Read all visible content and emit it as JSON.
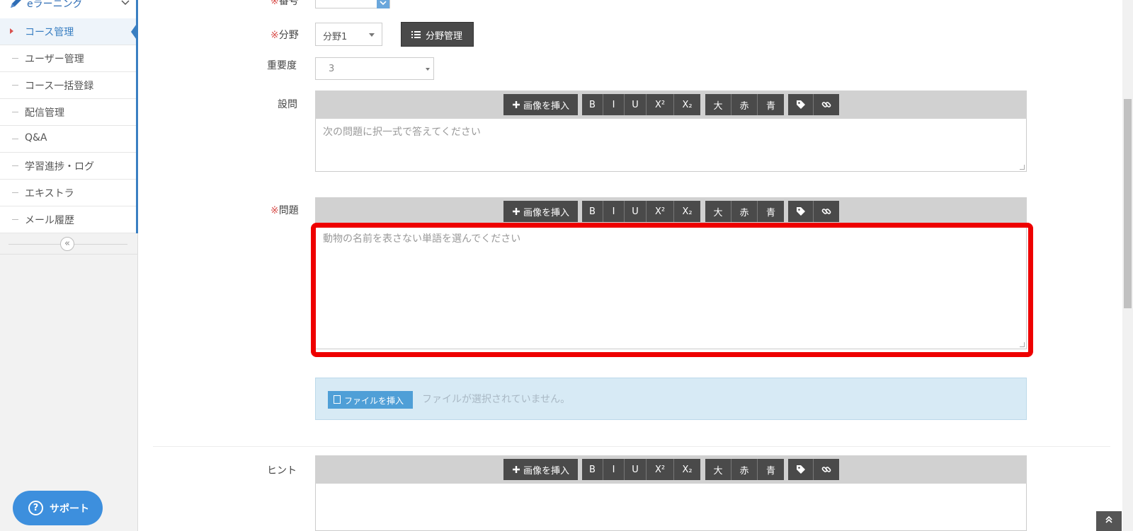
{
  "sidebar": {
    "section_label": "eラーニング",
    "items": [
      {
        "label": "コース管理"
      },
      {
        "label": "ユーザー管理"
      },
      {
        "label": "コース一括登録"
      },
      {
        "label": "配信管理"
      },
      {
        "label": "Q&A"
      },
      {
        "label": "学習進捗・ログ"
      },
      {
        "label": "エキストラ"
      },
      {
        "label": "メール履歴"
      }
    ],
    "collapse_symbol": "«",
    "support_label": "サポート"
  },
  "form": {
    "top_label": "番号",
    "required_mark": "※",
    "field_label": "分野",
    "field_value": "分野1",
    "field_manage_button": "分野管理",
    "importance_label": "重要度",
    "importance_value": "3",
    "question_label": "設問",
    "question_placeholder": "次の問題に択一式で答えてください",
    "problem_label": "問題",
    "problem_placeholder": "動物の名前を表さない単語を選んでください",
    "hint_label": "ヒント",
    "file_insert_button": "ファイルを挿入",
    "file_status": "ファイルが選択されていません。"
  },
  "toolbar": {
    "insert_image": "画像を挿入",
    "bold": "B",
    "italic": "I",
    "underline": "U",
    "superscript": "X²",
    "subscript": "X₂",
    "large": "大",
    "red": "赤",
    "blue": "青"
  },
  "colors": {
    "accent": "#3a7fc2",
    "highlight": "#ee0000",
    "required": "#d9534f",
    "support": "#3d8fdd"
  }
}
